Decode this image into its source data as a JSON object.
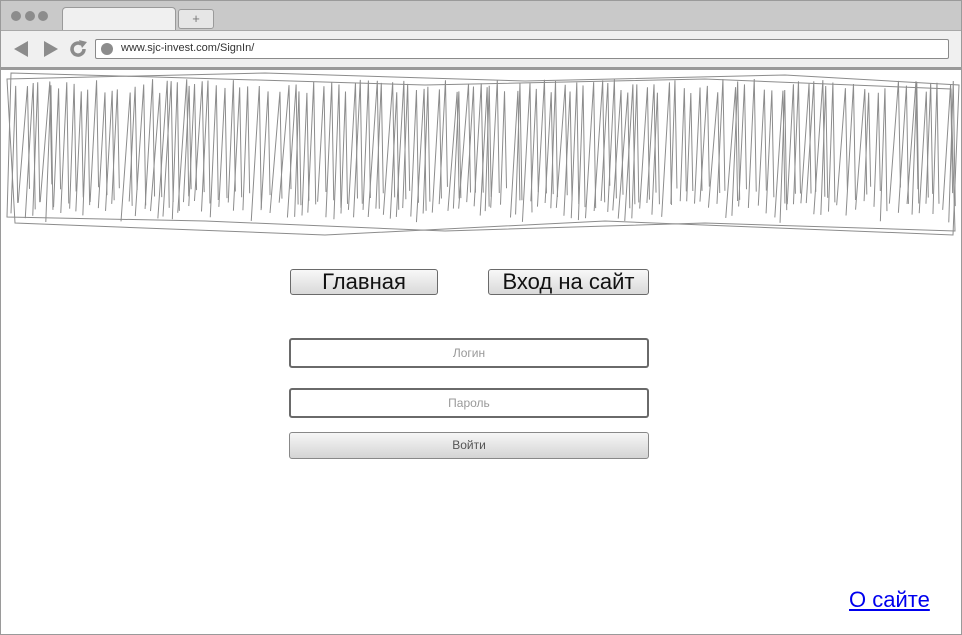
{
  "browser": {
    "new_tab_label": "+",
    "url": "www.sjc-invest.com/SignIn/"
  },
  "nav": {
    "home_label": "Главная",
    "signin_label": "Вход на сайт"
  },
  "form": {
    "login_placeholder": "Логин",
    "password_placeholder": "Пароль",
    "submit_label": "Войти"
  },
  "footer": {
    "about_label": "О сайте"
  },
  "colors": {
    "link": "#0000ee",
    "chrome": "#c9c9c9",
    "scribble": "#8c8c8c"
  }
}
